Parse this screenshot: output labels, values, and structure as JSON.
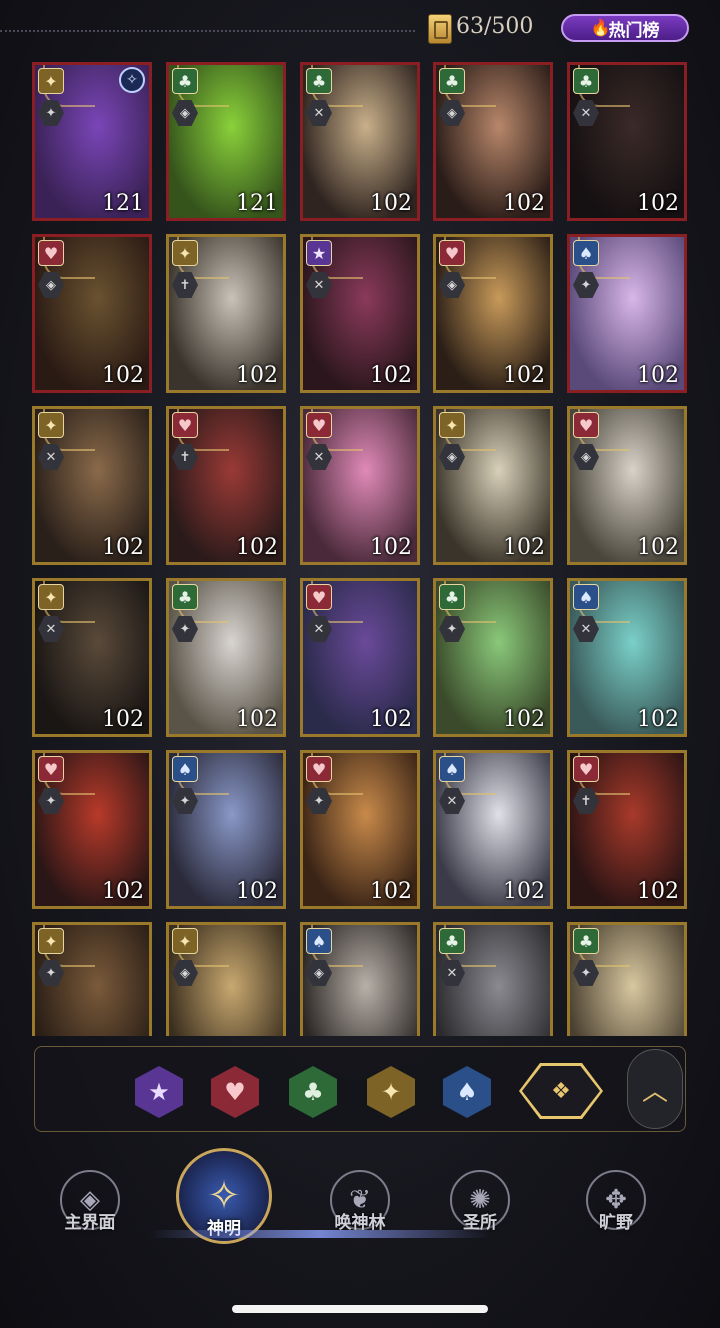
{
  "top": {
    "currency": "63/500",
    "hot_label": "热门榜"
  },
  "cards": [
    {
      "frame": "red",
      "suit": "diamond",
      "role": "✦",
      "level": "121",
      "tint": [
        "#7a46b8",
        "#3a2256"
      ],
      "topicon": true
    },
    {
      "frame": "red",
      "suit": "club",
      "role": "◈",
      "level": "121",
      "tint": [
        "#8ad13a",
        "#35541c"
      ]
    },
    {
      "frame": "red",
      "suit": "club",
      "role": "✕",
      "level": "102",
      "tint": [
        "#c9b08a",
        "#2f2420"
      ]
    },
    {
      "frame": "red",
      "suit": "club",
      "role": "◈",
      "level": "102",
      "tint": [
        "#b8876a",
        "#2a1c18"
      ]
    },
    {
      "frame": "red",
      "suit": "club",
      "role": "✕",
      "level": "102",
      "tint": [
        "#3b2a28",
        "#151012"
      ]
    },
    {
      "frame": "red",
      "suit": "heart",
      "role": "◈",
      "level": "102",
      "tint": [
        "#6a5230",
        "#2a1a14"
      ]
    },
    {
      "frame": "gold",
      "suit": "diamond",
      "role": "✝",
      "level": "102",
      "tint": [
        "#c8c2b8",
        "#3a342c"
      ]
    },
    {
      "frame": "gold",
      "suit": "star",
      "role": "✕",
      "level": "102",
      "tint": [
        "#8a3a5a",
        "#2a161c"
      ]
    },
    {
      "frame": "gold",
      "suit": "heart",
      "role": "◈",
      "level": "102",
      "tint": [
        "#c89a5a",
        "#2a1e16"
      ]
    },
    {
      "frame": "red",
      "suit": "spade",
      "role": "✦",
      "level": "102",
      "tint": [
        "#d8b6e8",
        "#5a4a7a"
      ]
    },
    {
      "frame": "gold",
      "suit": "diamond",
      "role": "✕",
      "level": "102",
      "tint": [
        "#8a6a4a",
        "#2a201a"
      ]
    },
    {
      "frame": "gold",
      "suit": "heart",
      "role": "✝",
      "level": "102",
      "tint": [
        "#9a3a36",
        "#2a1a1a"
      ]
    },
    {
      "frame": "gold",
      "suit": "heart",
      "role": "✕",
      "level": "102",
      "tint": [
        "#e08ab8",
        "#4a2a3a"
      ]
    },
    {
      "frame": "gold",
      "suit": "diamond",
      "role": "◈",
      "level": "102",
      "tint": [
        "#d8d0b8",
        "#3a342a"
      ]
    },
    {
      "frame": "gold",
      "suit": "heart",
      "role": "◈",
      "level": "102",
      "tint": [
        "#d8d2c8",
        "#4a463c"
      ]
    },
    {
      "frame": "gold",
      "suit": "diamond",
      "role": "✕",
      "level": "102",
      "tint": [
        "#5a4a3a",
        "#1a1614"
      ]
    },
    {
      "frame": "gold",
      "suit": "club",
      "role": "✦",
      "level": "102",
      "tint": [
        "#d8d4d0",
        "#5a5448"
      ]
    },
    {
      "frame": "gold",
      "suit": "heart",
      "role": "✕",
      "level": "102",
      "tint": [
        "#6a4a9a",
        "#2a2a4a"
      ]
    },
    {
      "frame": "gold",
      "suit": "club",
      "role": "✦",
      "level": "102",
      "tint": [
        "#8ac87a",
        "#3a4a2a"
      ]
    },
    {
      "frame": "gold",
      "suit": "spade",
      "role": "✕",
      "level": "102",
      "tint": [
        "#7ad0c8",
        "#3a5a5a"
      ]
    },
    {
      "frame": "gold",
      "suit": "heart",
      "role": "✦",
      "level": "102",
      "tint": [
        "#b83a2a",
        "#2a1616"
      ]
    },
    {
      "frame": "gold",
      "suit": "spade",
      "role": "✦",
      "level": "102",
      "tint": [
        "#8a98c8",
        "#2a2a3a"
      ]
    },
    {
      "frame": "gold",
      "suit": "heart",
      "role": "✦",
      "level": "102",
      "tint": [
        "#c88a4a",
        "#3a2416"
      ]
    },
    {
      "frame": "gold",
      "suit": "spade",
      "role": "✕",
      "level": "102",
      "tint": [
        "#e0e0e8",
        "#3a3a48"
      ]
    },
    {
      "frame": "gold",
      "suit": "heart",
      "role": "✝",
      "level": "102",
      "tint": [
        "#a83a2a",
        "#2a1414"
      ]
    },
    {
      "frame": "gold",
      "suit": "diamond",
      "role": "✦",
      "level": "",
      "tint": [
        "#7a5a3a",
        "#2a1e16"
      ]
    },
    {
      "frame": "gold",
      "suit": "diamond",
      "role": "◈",
      "level": "",
      "tint": [
        "#c8a870",
        "#3a2e1e"
      ]
    },
    {
      "frame": "gold",
      "suit": "spade",
      "role": "◈",
      "level": "",
      "tint": [
        "#b8b0a8",
        "#2a2624"
      ]
    },
    {
      "frame": "gold",
      "suit": "club",
      "role": "✕",
      "level": "",
      "tint": [
        "#8a8a90",
        "#2a2a2e"
      ]
    },
    {
      "frame": "gold",
      "suit": "club",
      "role": "✦",
      "level": "",
      "tint": [
        "#d8c8a0",
        "#4a4030"
      ]
    }
  ],
  "filters": [
    {
      "name": "star",
      "glyph": "★"
    },
    {
      "name": "heart",
      "glyph": "♥"
    },
    {
      "name": "club",
      "glyph": "♣"
    },
    {
      "name": "diamond",
      "glyph": "✦"
    },
    {
      "name": "spade",
      "glyph": "♠"
    }
  ],
  "filter_all_glyph": "❖",
  "collapse_glyph": "︿",
  "nav": [
    {
      "label": "主界面",
      "icon": "◈",
      "active": false
    },
    {
      "label": "神明",
      "icon": "✧",
      "active": true
    },
    {
      "label": "唤神林",
      "icon": "❦",
      "active": false
    },
    {
      "label": "圣所",
      "icon": "✺",
      "active": false
    },
    {
      "label": "旷野",
      "icon": "✥",
      "active": false
    }
  ]
}
